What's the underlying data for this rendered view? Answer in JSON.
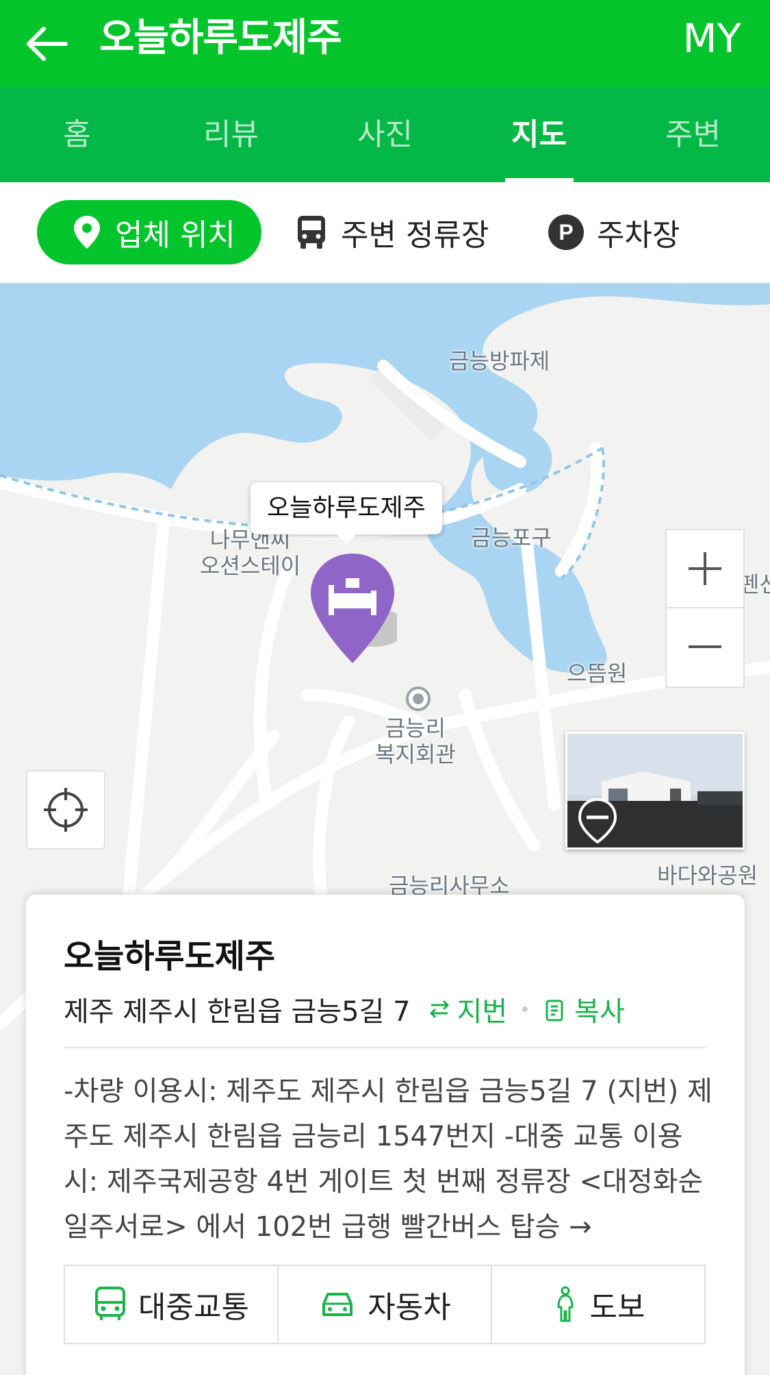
{
  "header": {
    "title": "오늘하루도제주",
    "my_label": "MY",
    "back_icon": "arrow-left-icon"
  },
  "tabs": [
    {
      "label": "홈"
    },
    {
      "label": "리뷰"
    },
    {
      "label": "사진"
    },
    {
      "label": "지도",
      "active": true
    },
    {
      "label": "주변"
    }
  ],
  "filters": {
    "location": "업체 위치",
    "bus_stop": "주변 정류장",
    "parking": "주차장"
  },
  "map": {
    "marker_label": "오늘하루도제주",
    "poi": {
      "a": "금능방파제",
      "b": "나무앤씨\n오션스테이",
      "c": "금능포구",
      "d": "으뜸원",
      "e": "금능리\n복지회관",
      "f": "금능리사무소",
      "g": "바다와공원",
      "h": "펜션"
    },
    "zoom_in": "+",
    "zoom_out": "−"
  },
  "card": {
    "title": "오늘하루도제주",
    "address": "제주 제주시 한림읍 금능5길 7",
    "jibun_label": "지번",
    "copy_label": "복사",
    "directions": "-차량 이용시: 제주도 제주시 한림읍 금능5길 7 (지번) 제주도 제주시 한림읍 금능리 1547번지 -대중 교통 이용시: 제주국제공항 4번 게이트 첫 번째 정류장 <대정화순 일주서로> 에서 102번 급행 빨간버스 탑승 →",
    "transport": [
      {
        "label": "대중교통",
        "icon": "bus-icon"
      },
      {
        "label": "자동차",
        "icon": "car-icon"
      },
      {
        "label": "도보",
        "icon": "walk-icon"
      }
    ]
  },
  "colors": {
    "brand": "#03c52b",
    "tabbar": "#03b847",
    "marker": "#8f66c8",
    "water": "#a9d5f2",
    "link": "#19b34a"
  }
}
